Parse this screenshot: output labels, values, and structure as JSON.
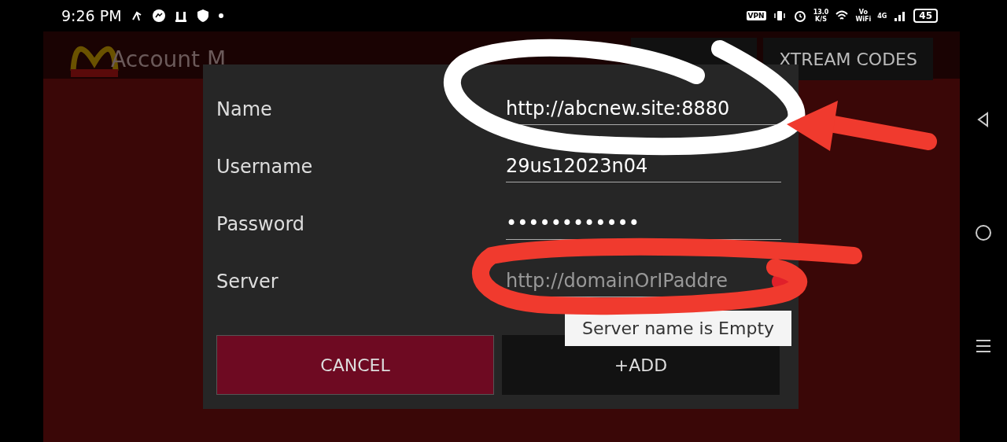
{
  "status_bar": {
    "time": "9:26 PM",
    "vpn": "VPN",
    "speed": "13.0",
    "speed_unit": "K/S",
    "volte": "Vo",
    "volte_sub": "WiFi",
    "network": "4G",
    "battery": "45"
  },
  "background": {
    "title": "Account M",
    "tabs": [
      {
        "label": "XTREAM CODES"
      }
    ]
  },
  "dialog": {
    "fields": [
      {
        "label": "Name",
        "value": "http://abcnew.site:8880",
        "error": false
      },
      {
        "label": "Username",
        "value": "29us12023n04",
        "error": false
      },
      {
        "label": "Password",
        "value": "••••••••••••",
        "error": false
      },
      {
        "label": "Server",
        "placeholder": "http://domainOrIPaddre",
        "error": true
      }
    ],
    "tooltip": "Server name is Empty",
    "buttons": [
      {
        "label": "CANCEL",
        "kind": "cancel"
      },
      {
        "label": "+ADD",
        "kind": "add"
      }
    ]
  }
}
